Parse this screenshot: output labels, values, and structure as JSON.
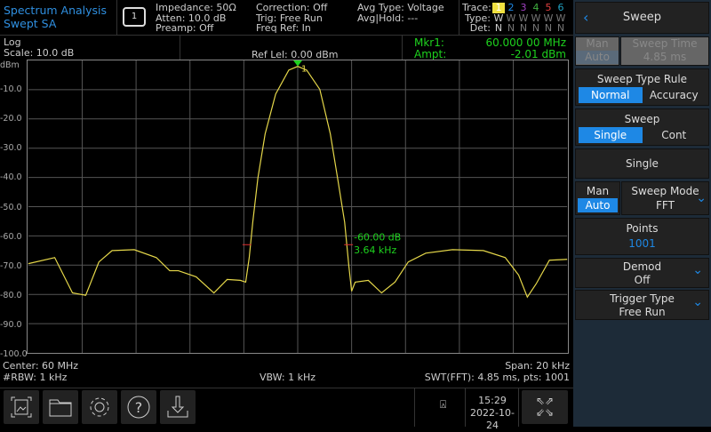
{
  "header": {
    "mode": "Spectrum Analysis",
    "measurement": "Swept SA",
    "sweep_icon": "single-sweep-icon",
    "sweep_count": "1",
    "info1": [
      "Impedance: 50Ω",
      "Atten: 10.0 dB",
      "Preamp: Off"
    ],
    "info2": [
      "Correction: Off",
      "Trig: Free Run",
      "Freq Ref: In"
    ],
    "info3": [
      "Avg Type: Voltage",
      "Avg|Hold: ---"
    ],
    "trace": {
      "labels": [
        "Trace:",
        "Type:",
        "Det:"
      ],
      "numbers": [
        "1",
        "2",
        "3",
        "4",
        "5",
        "6"
      ],
      "colors": [
        "#f0e040",
        "#1e88e5",
        "#a040c0",
        "#40b040",
        "#e04040",
        "#20a0c0"
      ],
      "types": [
        "W",
        "W",
        "W",
        "W",
        "W",
        "W"
      ],
      "dets": [
        "N",
        "N",
        "N",
        "N",
        "N",
        "N"
      ]
    }
  },
  "subheader": {
    "scale_type": "Log",
    "scale": "Scale: 10.0 dB",
    "ref_level": "Ref Lel: 0.00 dBm",
    "mkr_label": "Mkr1:",
    "mkr_value": "60.000 00 MHz",
    "ampt_label": "Ampt:",
    "ampt_value": "-2.01 dBm"
  },
  "chart_data": {
    "type": "line",
    "ylabel": "dBm",
    "yticks": [
      "dBm",
      "-10.0",
      "-20.0",
      "-30.0",
      "-40.0",
      "-50.0",
      "-60.0",
      "-70.0",
      "-80.0",
      "-90.0",
      "-100.0"
    ],
    "ylim": [
      -100,
      0
    ],
    "xlim_mhz": [
      59.99,
      60.01
    ],
    "grid": true,
    "trace_color": "#e6d84a",
    "x_mhz": [
      59.99,
      59.99098,
      59.99164,
      59.99213,
      59.99262,
      59.99311,
      59.99393,
      59.99475,
      59.99525,
      59.99557,
      59.99623,
      59.99689,
      59.99738,
      59.99787,
      59.99807,
      59.9982,
      59.99833,
      59.99852,
      59.99879,
      59.99918,
      59.99967,
      60.0,
      60.00033,
      60.00082,
      60.00121,
      60.00148,
      60.00174,
      60.0019,
      60.002,
      60.00213,
      60.00262,
      60.00311,
      60.00361,
      60.0041,
      60.00475,
      60.00574,
      60.00689,
      60.0077,
      60.0082,
      60.00852,
      60.00885,
      60.00934,
      60.01
    ],
    "y_dbm": [
      -69.5,
      -67.4,
      -79.5,
      -80.3,
      -68.9,
      -65.0,
      -64.7,
      -67.4,
      -71.9,
      -71.9,
      -74.0,
      -79.5,
      -74.9,
      -75.2,
      -75.8,
      -67.4,
      -55.3,
      -40.2,
      -25.1,
      -11.5,
      -3.3,
      -2.01,
      -3.3,
      -9.9,
      -25.1,
      -40.2,
      -55.3,
      -70.4,
      -78.9,
      -75.8,
      -75.2,
      -79.5,
      -75.8,
      -68.9,
      -65.9,
      -64.7,
      -65.0,
      -67.4,
      -73.4,
      -80.9,
      -76.4,
      -68.3,
      -68.0
    ],
    "marker": {
      "label": "1",
      "x_mhz": 60.0,
      "y_dbm": -2.01,
      "color": "#1ed21e"
    },
    "ndb": {
      "line1": "-60.00 dB",
      "line2": "3.64 kHz",
      "left_mhz": 59.99818,
      "right_mhz": 60.00182,
      "level_dbm": -63
    }
  },
  "footer": {
    "center": "Center: 60 MHz",
    "rbw": "#RBW: 1 kHz",
    "vbw": "VBW: 1 kHz",
    "span": "Span: 20 kHz",
    "swt": "SWT(FFT): 4.85 ms, pts: 1001"
  },
  "toolbar": {
    "time": "15:29",
    "date": "2022-10-24"
  },
  "menu": {
    "title": "Sweep",
    "sweep_time": {
      "man": "Man",
      "auto": "Auto",
      "label": "Sweep Time",
      "value": "4.85 ms"
    },
    "sweep_type_rule": {
      "label": "Sweep Type Rule",
      "opt1": "Normal",
      "opt2": "Accuracy"
    },
    "sweep": {
      "label": "Sweep",
      "opt1": "Single",
      "opt2": "Cont"
    },
    "single": "Single",
    "sweep_mode": {
      "man": "Man",
      "auto": "Auto",
      "label": "Sweep Mode",
      "value": "FFT"
    },
    "points": {
      "label": "Points",
      "value": "1001"
    },
    "demod": {
      "label": "Demod",
      "value": "Off"
    },
    "trigger": {
      "label": "Trigger Type",
      "value": "Free Run"
    }
  }
}
